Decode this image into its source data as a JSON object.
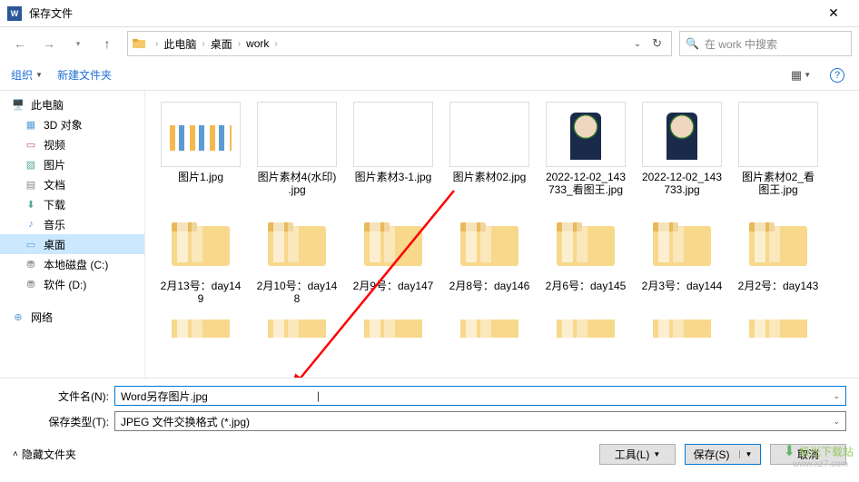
{
  "window": {
    "title": "保存文件",
    "app_badge": "W"
  },
  "nav": {
    "breadcrumb": [
      "此电脑",
      "桌面",
      "work"
    ],
    "search_placeholder": "在 work 中搜索"
  },
  "toolbar": {
    "organize": "组织",
    "new_folder": "新建文件夹"
  },
  "sidebar": {
    "items": [
      {
        "label": "此电脑",
        "icon": "pc",
        "root": true
      },
      {
        "label": "3D 对象",
        "icon": "3d"
      },
      {
        "label": "视频",
        "icon": "video"
      },
      {
        "label": "图片",
        "icon": "pic"
      },
      {
        "label": "文档",
        "icon": "doc"
      },
      {
        "label": "下载",
        "icon": "dl"
      },
      {
        "label": "音乐",
        "icon": "music"
      },
      {
        "label": "桌面",
        "icon": "desk",
        "selected": true
      },
      {
        "label": "本地磁盘 (C:)",
        "icon": "disk"
      },
      {
        "label": "软件 (D:)",
        "icon": "disk"
      },
      {
        "label": "网络",
        "icon": "net",
        "root": true,
        "gap": true
      }
    ]
  },
  "files": {
    "row1": [
      {
        "name": "图片1.jpg",
        "thumb": "chart"
      },
      {
        "name": "图片素材4(水印) .jpg",
        "thumb": "face1"
      },
      {
        "name": "图片素材3-1.jpg",
        "thumb": "face2"
      },
      {
        "name": "图片素材02.jpg",
        "thumb": "beach"
      },
      {
        "name": "2022-12-02_143733_看图王.jpg",
        "thumb": "model"
      },
      {
        "name": "2022-12-02_143733.jpg",
        "thumb": "model"
      },
      {
        "name": "图片素材02_看图王.jpg",
        "thumb": "beach"
      }
    ],
    "row2": [
      {
        "name": "2月13号：day149",
        "thumb": "folder"
      },
      {
        "name": "2月10号：day148",
        "thumb": "folder"
      },
      {
        "name": "2月9号：day147",
        "thumb": "folder"
      },
      {
        "name": "2月8号：day146",
        "thumb": "folder"
      },
      {
        "name": "2月6号：day145",
        "thumb": "folder"
      },
      {
        "name": "2月3号：day144",
        "thumb": "folder"
      },
      {
        "name": "2月2号：day143",
        "thumb": "folder"
      }
    ]
  },
  "form": {
    "filename_label": "文件名(N):",
    "filename_value": "Word另存图片.jpg",
    "filetype_label": "保存类型(T):",
    "filetype_value": "JPEG 文件交换格式 (*.jpg)"
  },
  "footer": {
    "hide_folders": "隐藏文件夹",
    "tools": "工具(L)",
    "save": "保存(S)",
    "cancel": "取消"
  },
  "watermark": {
    "text": "极光下载站",
    "url": "www.xz7.com"
  }
}
